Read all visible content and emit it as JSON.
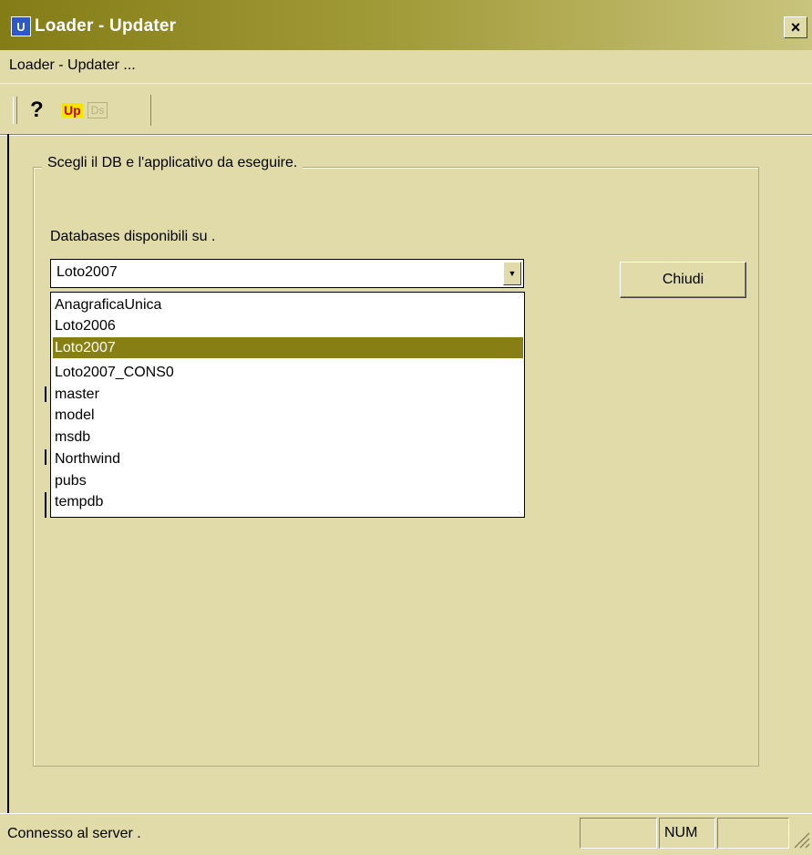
{
  "window": {
    "title": "Loader - Updater",
    "app_icon_glyph": "U",
    "close_glyph": "×"
  },
  "menu": {
    "items": [
      "Loader - Updater ..."
    ]
  },
  "toolbar": {
    "buttons": [
      {
        "name": "help",
        "glyph": "?"
      },
      {
        "name": "up",
        "glyph": "Up"
      },
      {
        "name": "ds",
        "glyph": "Ds",
        "disabled": true
      }
    ]
  },
  "group": {
    "legend": "Scegli il DB e l'applicativo da eseguire.",
    "databases_label": "Databases disponibili su .",
    "selected_db": "Loto2007",
    "options": [
      "AnagraficaUnica",
      "Loto2006",
      "Loto2007",
      "Loto2007_CONS0",
      "master",
      "model",
      "msdb",
      "Northwind",
      "pubs",
      "tempdb"
    ],
    "highlighted_index": 2
  },
  "buttons": {
    "close_label": "Chiudi"
  },
  "status": {
    "text": "Connesso al server .",
    "panes": [
      "",
      "NUM",
      ""
    ]
  },
  "colors": {
    "face": "#e0dba9",
    "titlebar_start": "#847c16",
    "highlight": "#877f13"
  }
}
